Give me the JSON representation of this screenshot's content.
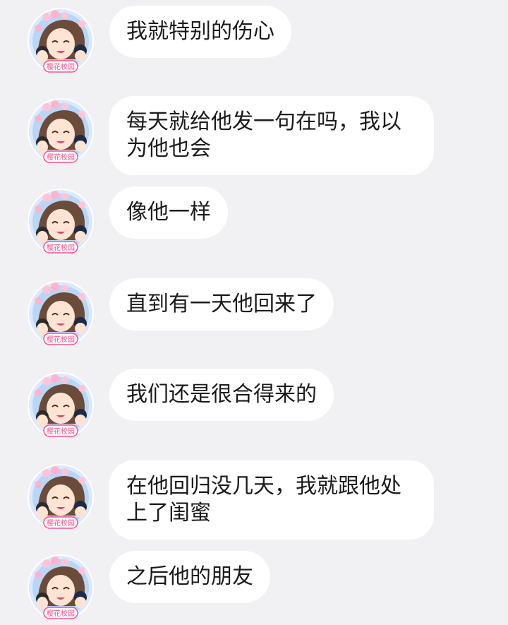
{
  "messages": [
    {
      "text": "我就特别的伤心"
    },
    {
      "text": "每天就给他发一句在吗，我以为他也会"
    },
    {
      "text": "像他一样"
    },
    {
      "text": "直到有一天他回来了"
    },
    {
      "text": "我们还是很合得来的"
    },
    {
      "text": "在他回归没几天，我就跟他处上了闺蜜"
    },
    {
      "text": "之后他的朋友"
    }
  ],
  "avatar": {
    "badge_text": "樱花校园",
    "icon": "anime-avatar-icon"
  },
  "colors": {
    "background": "#f1f1f3",
    "bubble": "#ffffff",
    "text": "#1a1a1a",
    "badge": "#ff4f8b"
  }
}
